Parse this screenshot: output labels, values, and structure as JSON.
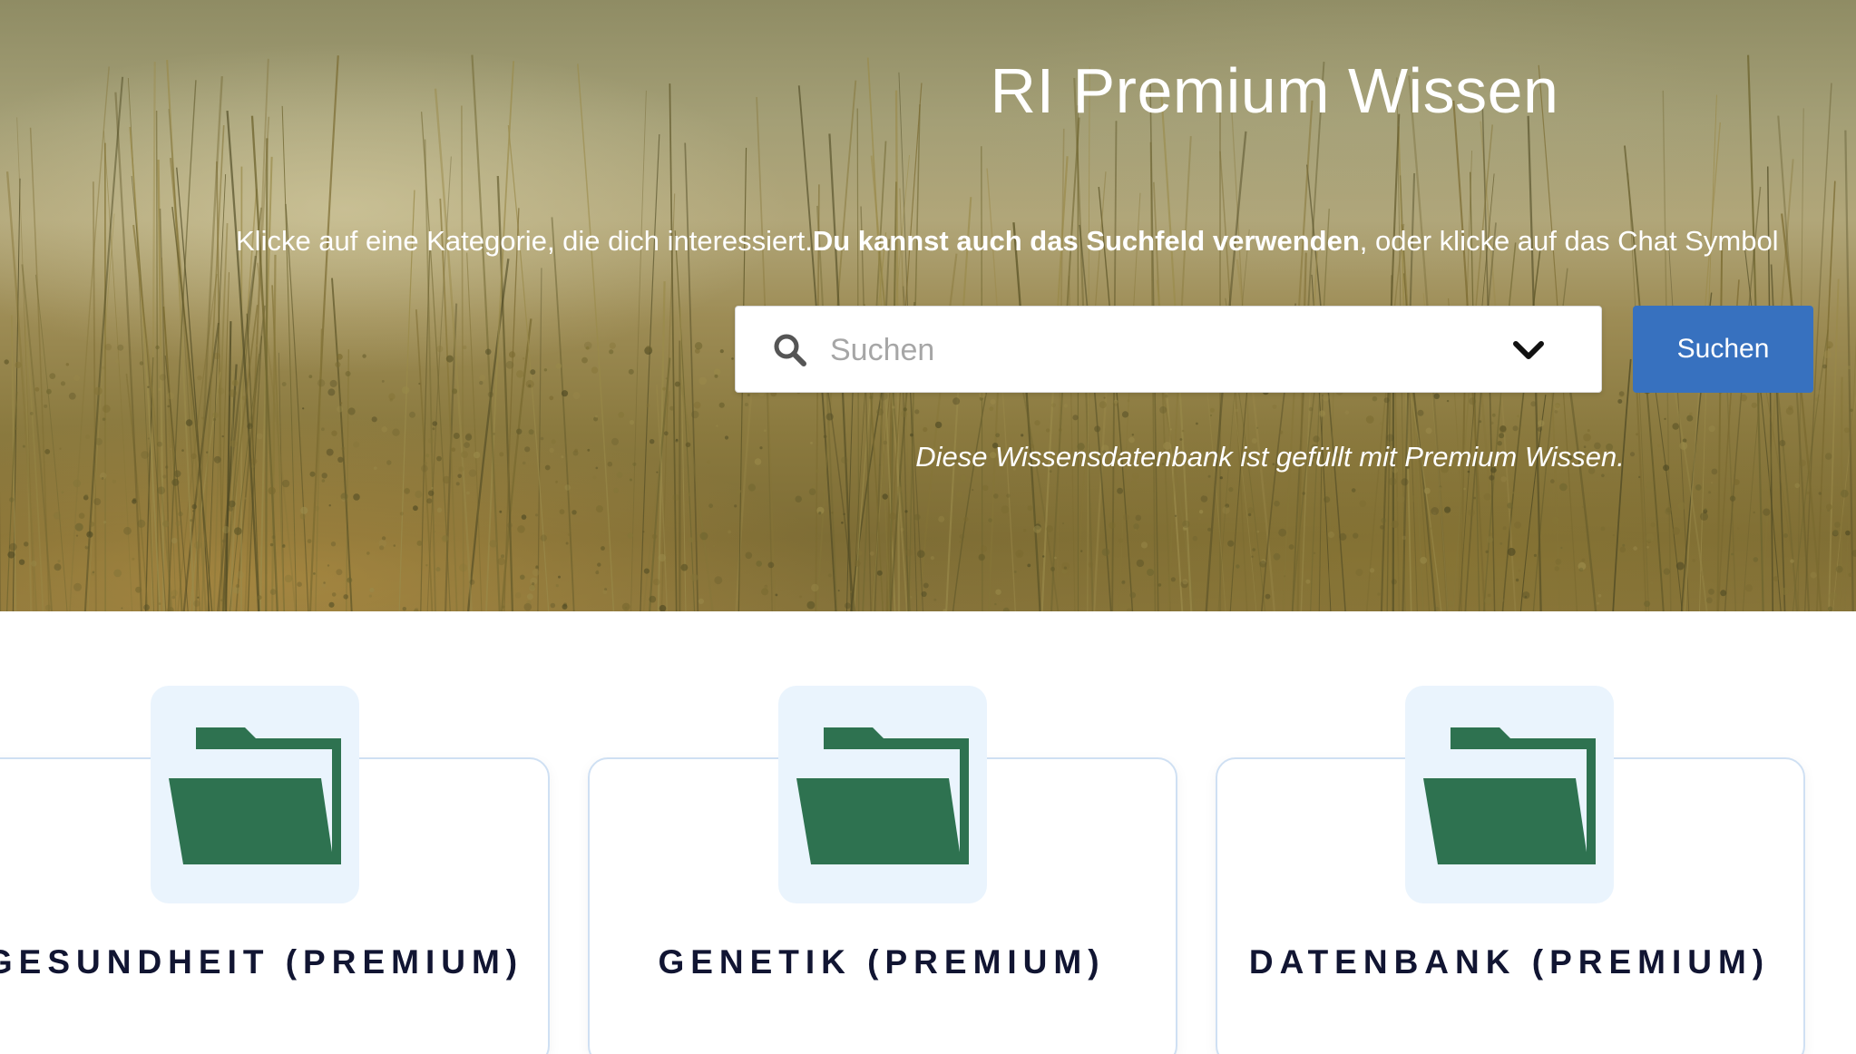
{
  "hero": {
    "title": "RI Premium Wissen",
    "intro_text": "Klicke auf eine Kategorie, die dich interessiert.",
    "intro_bold": "Du kannst auch das Suchfeld verwenden",
    "intro_rest": ", oder klicke auf das Chat Symbol",
    "note": "Diese Wissensdatenbank ist gefüllt mit Premium Wissen."
  },
  "search": {
    "placeholder": "Suchen",
    "value": "",
    "button_label": "Suchen",
    "icon": "search-icon",
    "dropdown_icon": "chevron-down-icon"
  },
  "categories": [
    {
      "label": "GESUNDHEIT (PREMIUM)",
      "icon": "folder-icon"
    },
    {
      "label": "GENETIK (PREMIUM)",
      "icon": "folder-icon"
    },
    {
      "label": "DATENBANK (PREMIUM)",
      "icon": "folder-icon"
    }
  ],
  "colors": {
    "primary_button": "#3771bf",
    "folder_green": "#2e7250",
    "icon_tile_bg": "#eaf4fd",
    "card_border": "#cfe0f3",
    "label_text": "#111532"
  }
}
